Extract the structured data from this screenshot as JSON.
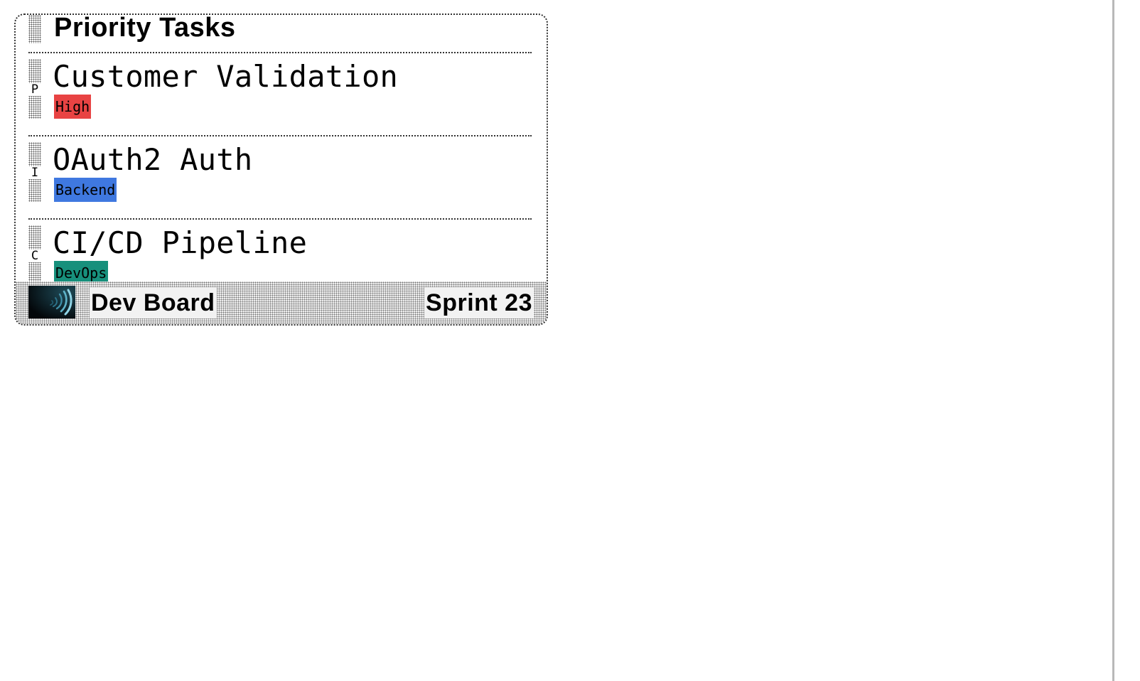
{
  "board": {
    "title": "Priority Tasks"
  },
  "tasks": [
    {
      "initial": "P",
      "name": "Customer Validation",
      "tag": "High",
      "tag_color": "#e84343"
    },
    {
      "initial": "I",
      "name": "OAuth2 Auth",
      "tag": "Backend",
      "tag_color": "#3f78e0"
    },
    {
      "initial": "C",
      "name": "CI/CD Pipeline",
      "tag": "DevOps",
      "tag_color": "#17907c"
    }
  ],
  "footer": {
    "brand": "Dev Board",
    "sprint": "Sprint 23",
    "logo_icon": "spiral-logo-icon"
  }
}
